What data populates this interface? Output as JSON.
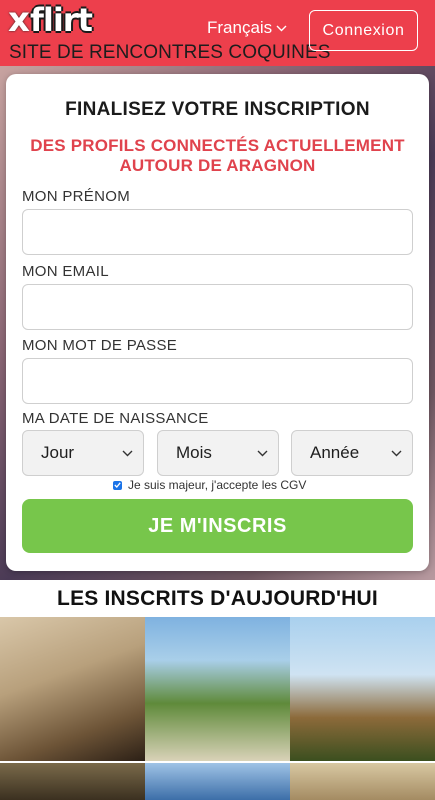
{
  "header": {
    "logo_mark": "x",
    "logo_text": "flirt",
    "tagline": "SITE DE RENCONTRES COQUINES",
    "language": "Français",
    "login_label": "Connexion"
  },
  "signup": {
    "title": "FINALISEZ VOTRE INSCRIPTION",
    "subtitle": "DES PROFILS CONNECTÉS ACTUELLEMENT AUTOUR DE ARAGNON",
    "first_name_label": "MON PRÉNOM",
    "first_name_value": "",
    "email_label": "MON EMAIL",
    "email_value": "",
    "password_label": "MON MOT DE PASSE",
    "password_value": "",
    "birthdate_label": "MA DATE DE NAISSANCE",
    "day_label": "Jour",
    "month_label": "Mois",
    "year_label": "Année",
    "terms_label": "Je suis majeur, j'accepte les CGV",
    "terms_checked": true,
    "submit_label": "JE M'INSCRIS"
  },
  "members": {
    "title": "LES INSCRITS D'AUJOURD'HUI",
    "photos": [
      "member-photo",
      "member-photo",
      "member-photo",
      "member-photo",
      "member-photo",
      "member-photo"
    ]
  },
  "colors": {
    "brand_red": "#ed3f4c",
    "accent_red": "#e0434d",
    "button_green": "#77c64b"
  },
  "icons": {
    "language_dropdown": "chevron-down-icon",
    "select_dropdown": "chevron-down-icon",
    "checkbox": "check-icon"
  }
}
